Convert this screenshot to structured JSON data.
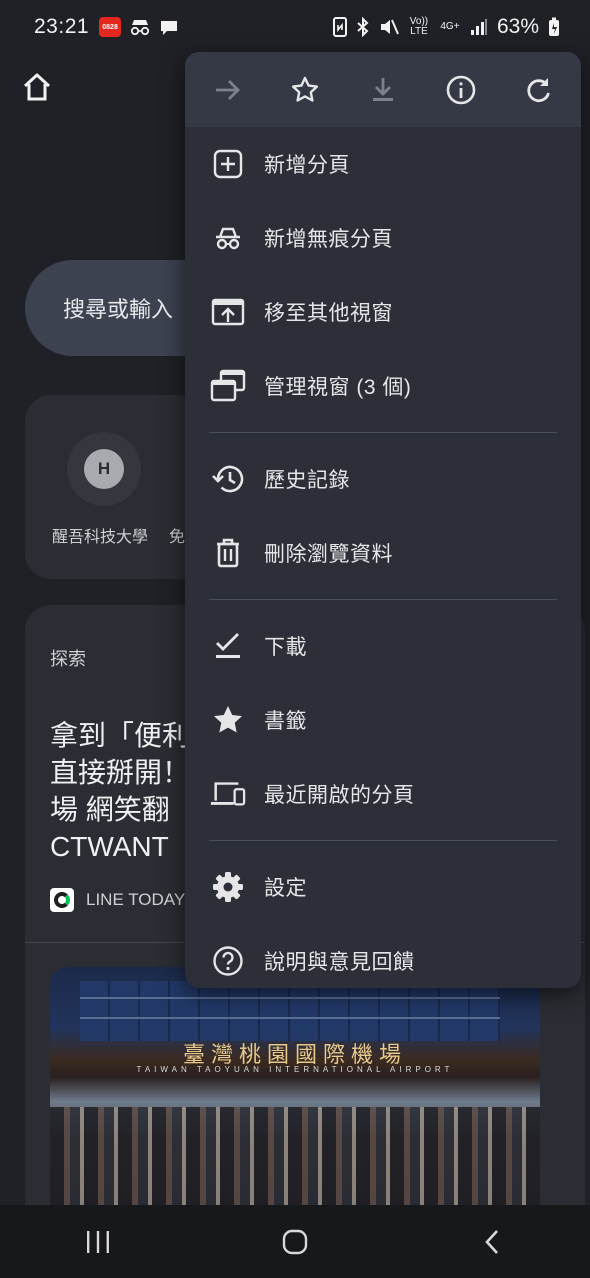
{
  "status_bar": {
    "time": "23:21",
    "app_badge": "0828",
    "network": "4G+",
    "volte": "Vo)) LTE",
    "battery": "63%"
  },
  "background": {
    "search_placeholder": "搜尋或輸入",
    "shortcut": {
      "avatar_letter": "H",
      "label": "醒吾科技大學",
      "label2": "免"
    },
    "discover": {
      "title": "探索",
      "article_lines": [
        "拿到「便利",
        "直接掰開！",
        "場 網笑翻",
        "CTWANT"
      ],
      "source": "LINE TODAY",
      "image_sign_zh": "臺灣桃園國際機場",
      "image_sign_en": "TAIWAN TAOYUAN INTERNATIONAL AIRPORT"
    }
  },
  "menu": {
    "toolbar": [
      {
        "name": "forward",
        "icon": "arrow-right-icon",
        "enabled": false
      },
      {
        "name": "bookmark",
        "icon": "star-outline-icon",
        "enabled": true
      },
      {
        "name": "download",
        "icon": "download-icon",
        "enabled": false
      },
      {
        "name": "page-info",
        "icon": "info-icon",
        "enabled": true
      },
      {
        "name": "reload",
        "icon": "reload-icon",
        "enabled": true
      }
    ],
    "items": [
      {
        "label": "新增分頁",
        "icon": "new-tab-icon"
      },
      {
        "label": "新增無痕分頁",
        "icon": "incognito-icon"
      },
      {
        "label": "移至其他視窗",
        "icon": "move-window-icon"
      },
      {
        "label": "管理視窗 (3 個)",
        "icon": "manage-windows-icon"
      },
      {
        "label": "歷史記錄",
        "icon": "history-icon"
      },
      {
        "label": "刪除瀏覽資料",
        "icon": "trash-icon"
      },
      {
        "label": "下載",
        "icon": "downloads-check-icon"
      },
      {
        "label": "書籤",
        "icon": "star-filled-icon"
      },
      {
        "label": "最近開啟的分頁",
        "icon": "devices-icon"
      },
      {
        "label": "設定",
        "icon": "gear-icon"
      },
      {
        "label": "說明與意見回饋",
        "icon": "help-icon"
      }
    ]
  },
  "colors": {
    "menu_bg": "#2c2f37",
    "menu_toolbar_bg": "#353945",
    "page_bg": "#1f2126",
    "card_bg": "#2a2d33",
    "disabled_icon": "#7c808a",
    "icon": "#e6e6e9"
  }
}
